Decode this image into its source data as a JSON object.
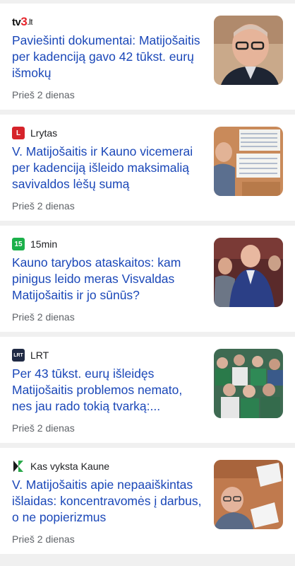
{
  "articles": [
    {
      "source_name": "tv3.lt",
      "logo_parts": [
        "tv",
        "3",
        ".lt"
      ],
      "headline": "Paviešinti dokumentai: Matijošaitis per kadenciją gavo 42 tūkst. eurų išmokų",
      "time": "Prieš 2 dienas"
    },
    {
      "source_name": "Lrytas",
      "logo_text": "L",
      "logo_color": "#d6232a",
      "headline": "V. Matijošaitis ir Kauno vicemerai per kadenciją išleido maksimalią savivaldos lėšų sumą",
      "time": "Prieš 2 dienas"
    },
    {
      "source_name": "15min",
      "logo_text": "15",
      "logo_color": "#1bb04a",
      "headline": "Kauno tarybos ataskaitos: kam pinigus leido meras Visvaldas Matijošaitis ir jo sūnūs?",
      "time": "Prieš 2 dienas"
    },
    {
      "source_name": "LRT",
      "logo_text": "LRT",
      "logo_color": "#1f2a44",
      "headline": "Per 43 tūkst. eurų išleidęs Matijošaitis problemos nemato, nes jau rado tokią tvarką:...",
      "time": "Prieš 2 dienas"
    },
    {
      "source_name": "Kas vyksta Kaune",
      "logo_text": "K",
      "logo_color": "#1e7a3a",
      "headline": "V. Matijošaitis apie nepaaiškintas išlaidas: koncentravomės į darbus, o ne popierizmus",
      "time": "Prieš 2 dienas"
    }
  ]
}
